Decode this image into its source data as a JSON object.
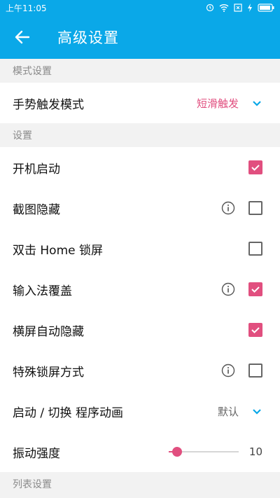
{
  "status": {
    "time": "上午11:05"
  },
  "appbar": {
    "title": "高级设置"
  },
  "sections": {
    "mode": "模式设置",
    "settings": "设置",
    "list": "列表设置"
  },
  "rows": {
    "gesture": {
      "label": "手势触发模式",
      "value": "短滑触发"
    },
    "boot": {
      "label": "开机启动",
      "checked": true
    },
    "screenshot_hide": {
      "label": "截图隐藏",
      "checked": false
    },
    "double_home": {
      "label": "双击 Home 锁屏",
      "checked": false
    },
    "ime_cover": {
      "label": "输入法覆盖",
      "checked": true
    },
    "landscape_hide": {
      "label": "横屏自动隐藏",
      "checked": true
    },
    "special_lock": {
      "label": "特殊锁屏方式",
      "checked": false
    },
    "anim": {
      "label": "启动 / 切换 程序动画",
      "value": "默认"
    },
    "vibration": {
      "label": "振动强度",
      "value": "10",
      "level_fraction": 0.12
    }
  },
  "colors": {
    "accent": "#0aa8e8",
    "pink": "#e14f7f"
  }
}
